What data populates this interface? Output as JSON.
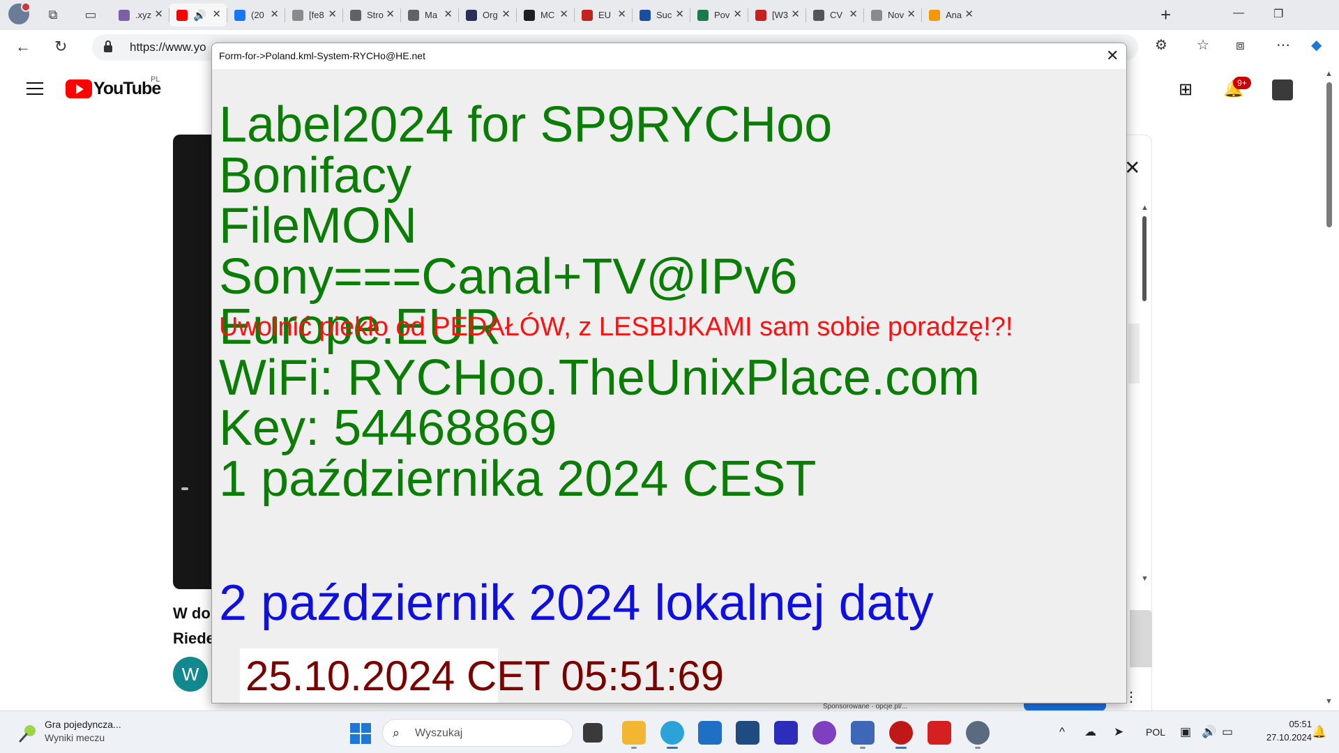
{
  "browser": {
    "tabs": [
      {
        "label": ".xyz",
        "color": "#7b5fa8"
      },
      {
        "label": "",
        "color": "#ff0000"
      },
      {
        "label": "(20",
        "color": "#1877f2"
      },
      {
        "label": "[fe8",
        "color": "#8a8a8a"
      },
      {
        "label": "Stro",
        "color": "#5f6368"
      },
      {
        "label": "Ma",
        "color": "#5f6368"
      },
      {
        "label": "Org",
        "color": "#2d2d5a"
      },
      {
        "label": "MC",
        "color": "#1f1f1f"
      },
      {
        "label": "EU",
        "color": "#c5221f"
      },
      {
        "label": "Suc",
        "color": "#1a4fa0"
      },
      {
        "label": "Pov",
        "color": "#1a7a4a"
      },
      {
        "label": "[W3",
        "color": "#c5221f"
      },
      {
        "label": "CV",
        "color": "#555555"
      },
      {
        "label": "Nov",
        "color": "#8a8a8a"
      },
      {
        "label": "Ana",
        "color": "#f29900"
      }
    ],
    "url": "https://www.yo"
  },
  "youtube": {
    "logo_text": "YouTube",
    "region": "PL",
    "notification_count": "9+",
    "video_title_line1": "W do",
    "video_title_line2": "Riede",
    "channel_initial": "W",
    "behind_text": "Sponsorowane · opcje.pl/..."
  },
  "dialog": {
    "title": "Form-for->Poland.kml-System-RYCHo@HE.net",
    "lines": [
      "Label2024 for SP9RYCHoo",
      "Bonifacy",
      "FileMON",
      "Sony===Canal+TV@IPv6",
      "Europe.EUR",
      "WiFi: RYCHoo.TheUnixPlace.com",
      "Key: 54468869",
      "1 października 2024 CEST"
    ],
    "red_line": "Uwolnić piekło od PEDAŁÓW, z LESBIJKAMI sam sobie poradzę!?!",
    "blue_line": "2 październik 2024 lokalnej daty",
    "time_value": "25.10.2024 CET 05:51:69",
    "colors": {
      "green": "#0a7d05",
      "red": "#ff1010",
      "blue": "#0f0fe0",
      "time": "#7a0000"
    }
  },
  "taskbar": {
    "widget_title": "Gra pojedyncza...",
    "widget_subtitle": "Wyniki meczu",
    "search_placeholder": "Wyszukaj",
    "language": "POL",
    "time": "05:51",
    "date": "27.10.2024"
  }
}
